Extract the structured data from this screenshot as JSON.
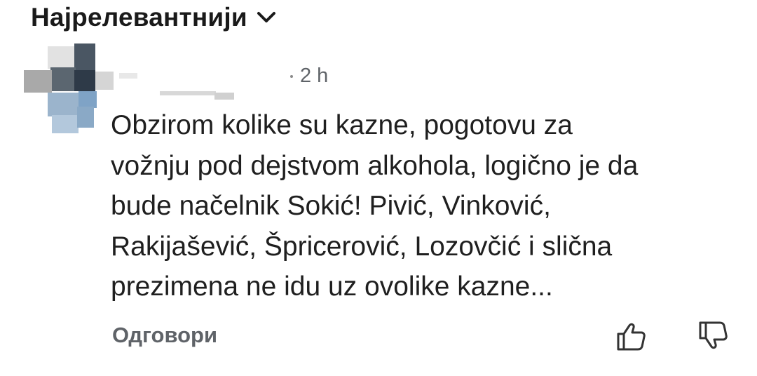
{
  "sort": {
    "label": "Најрелевантнији"
  },
  "comment": {
    "time": "2 h",
    "text": "Obzirom kolike su kazne, pogotovu za\nvožnju pod dejstvom alkohola, logično je da\nbude načelnik Sokić! Pivić, Vinković,\nRakijašević, Špricerović, Lozovčić i slična\nprezimena ne idu uz ovolike kazne...",
    "reply_label": "Одговори"
  },
  "icons": {
    "sort": "chevron-down-icon",
    "like": "thumbs-up-icon",
    "dislike": "thumbs-down-icon"
  },
  "colors": {
    "text": "#1f1f1f",
    "muted": "#5f6368"
  }
}
